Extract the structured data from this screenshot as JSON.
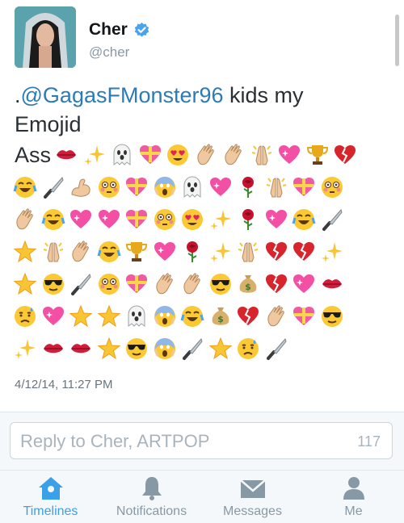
{
  "profile": {
    "name": "Cher",
    "handle": "@cher",
    "avatar_icon": "profile-photo",
    "verified_icon": "verified-badge-icon"
  },
  "tweet": {
    "prefix": ".",
    "mention": "@GagasFMonster96",
    "text_after_mention": " kids my",
    "line2": "Emojid",
    "line3_word": "Ass"
  },
  "emoji_rows": [
    [
      "lips",
      "sparkles",
      "ghost",
      "gift-heart",
      "heart-eyes",
      "clap",
      "clap",
      "pray",
      "sparkling-heart",
      "trophy",
      "broken-heart"
    ],
    [
      "joy",
      "knife",
      "muscle",
      "flushed",
      "gift-heart",
      "scream",
      "ghost",
      "sparkling-heart",
      "rose",
      "pray",
      "gift-heart",
      "flushed"
    ],
    [
      "clap",
      "joy",
      "sparkling-heart",
      "sparkling-heart",
      "gift-heart",
      "flushed",
      "heart-eyes",
      "sparkles",
      "rose",
      "sparkling-heart",
      "joy",
      "knife"
    ],
    [
      "glowing-star",
      "pray",
      "clap",
      "joy",
      "trophy",
      "sparkling-heart",
      "rose",
      "sparkles",
      "pray",
      "broken-heart",
      "broken-heart",
      "sparkles"
    ],
    [
      "glowing-star",
      "sunglasses",
      "knife",
      "flushed",
      "gift-heart",
      "clap",
      "clap",
      "sunglasses",
      "money-bag",
      "broken-heart",
      "sparkling-heart",
      "lips"
    ],
    [
      "sad-sweat",
      "sparkling-heart",
      "glowing-star",
      "glowing-star",
      "ghost",
      "scream",
      "joy",
      "money-bag",
      "broken-heart",
      "clap",
      "gift-heart",
      "sunglasses"
    ],
    [
      "sparkles",
      "lips",
      "lips",
      "glowing-star",
      "sunglasses",
      "scream",
      "knife",
      "glowing-star",
      "sad-sweat",
      "knife"
    ]
  ],
  "timestamp": "4/12/14, 11:27 PM",
  "reply": {
    "placeholder": "Reply to Cher, ARTPOP",
    "count": "117"
  },
  "tabs": [
    {
      "label": "Timelines",
      "icon": "home-icon",
      "active": true
    },
    {
      "label": "Notifications",
      "icon": "bell-icon",
      "active": false
    },
    {
      "label": "Messages",
      "icon": "envelope-icon",
      "active": false
    },
    {
      "label": "Me",
      "icon": "person-icon",
      "active": false
    }
  ],
  "colors": {
    "accent": "#3aa0e8",
    "link": "#2b7bb9",
    "muted": "#8899a6"
  }
}
